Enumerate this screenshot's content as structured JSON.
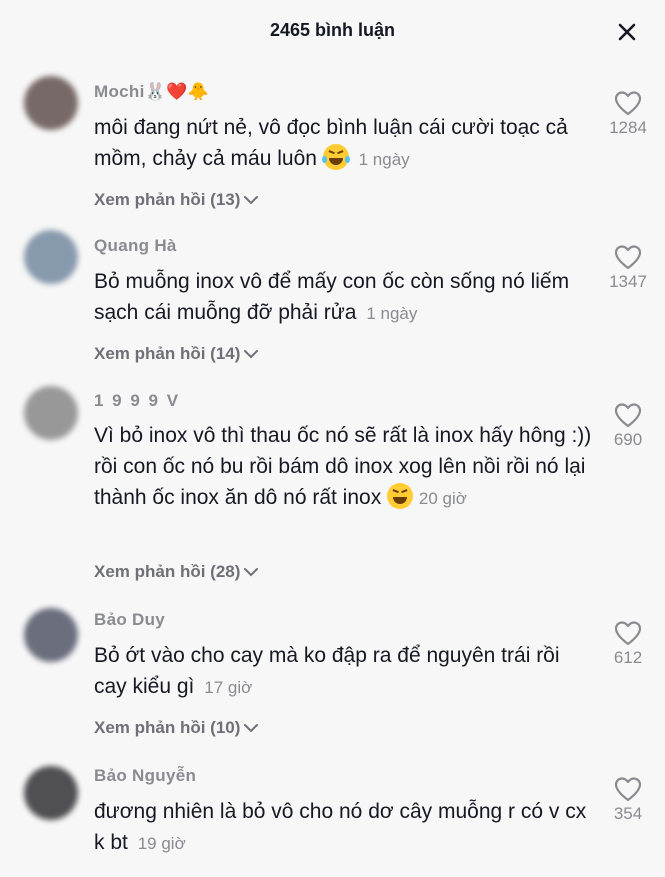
{
  "header": {
    "title": "2465 bình luận",
    "close_icon": "close-icon"
  },
  "comments": [
    {
      "username": "Mochi",
      "name_emojis": "🐰❤️🐥",
      "text": "môi đang nứt nẻ, vô đọc bình luận cái cười toạc cả mồm, chảy cả máu luôn",
      "emoji": "laughing-tears-emoji",
      "time": "1 ngày",
      "replies": "Xem phản hồi (13)",
      "likes": "1284",
      "avatar_color": "#6a5a58"
    },
    {
      "username": "Quang Hà",
      "text": "Bỏ muỗng inox vô để mấy con ốc còn sống nó liếm sạch cái muỗng đỡ phải rửa",
      "time": "1 ngày",
      "replies": "Xem phản hồi (14)",
      "likes": "1347",
      "avatar_color": "#7b8fa5"
    },
    {
      "username": "1 9 9 9 V",
      "text": "Vì bỏ inox vô thì thau ốc nó sẽ rất là inox hấy hông :)) rồi con ốc nó bu rồi bám dô inox xog lên nồi rồi nó lại thành ốc inox ăn dô nó rất inox",
      "emoji": "grinning-squint-emoji",
      "time": "20 giờ",
      "replies": "Xem phản hồi (28)",
      "likes": "690",
      "avatar_color": "#8e8e8e"
    },
    {
      "username": "Bảo Duy",
      "text": "Bỏ ớt vào cho cay mà ko đập ra để nguyên trái rồi cay kiểu gì",
      "time": "17 giờ",
      "replies": "Xem phản hồi (10)",
      "likes": "612",
      "avatar_color": "#5b6070"
    },
    {
      "username": "Bảo Nguyễn",
      "text": "đương nhiên là bỏ vô cho nó dơ cây muỗng r có v cx k bt",
      "time": "19 giờ",
      "likes": "354",
      "avatar_color": "#3e3e42"
    }
  ]
}
